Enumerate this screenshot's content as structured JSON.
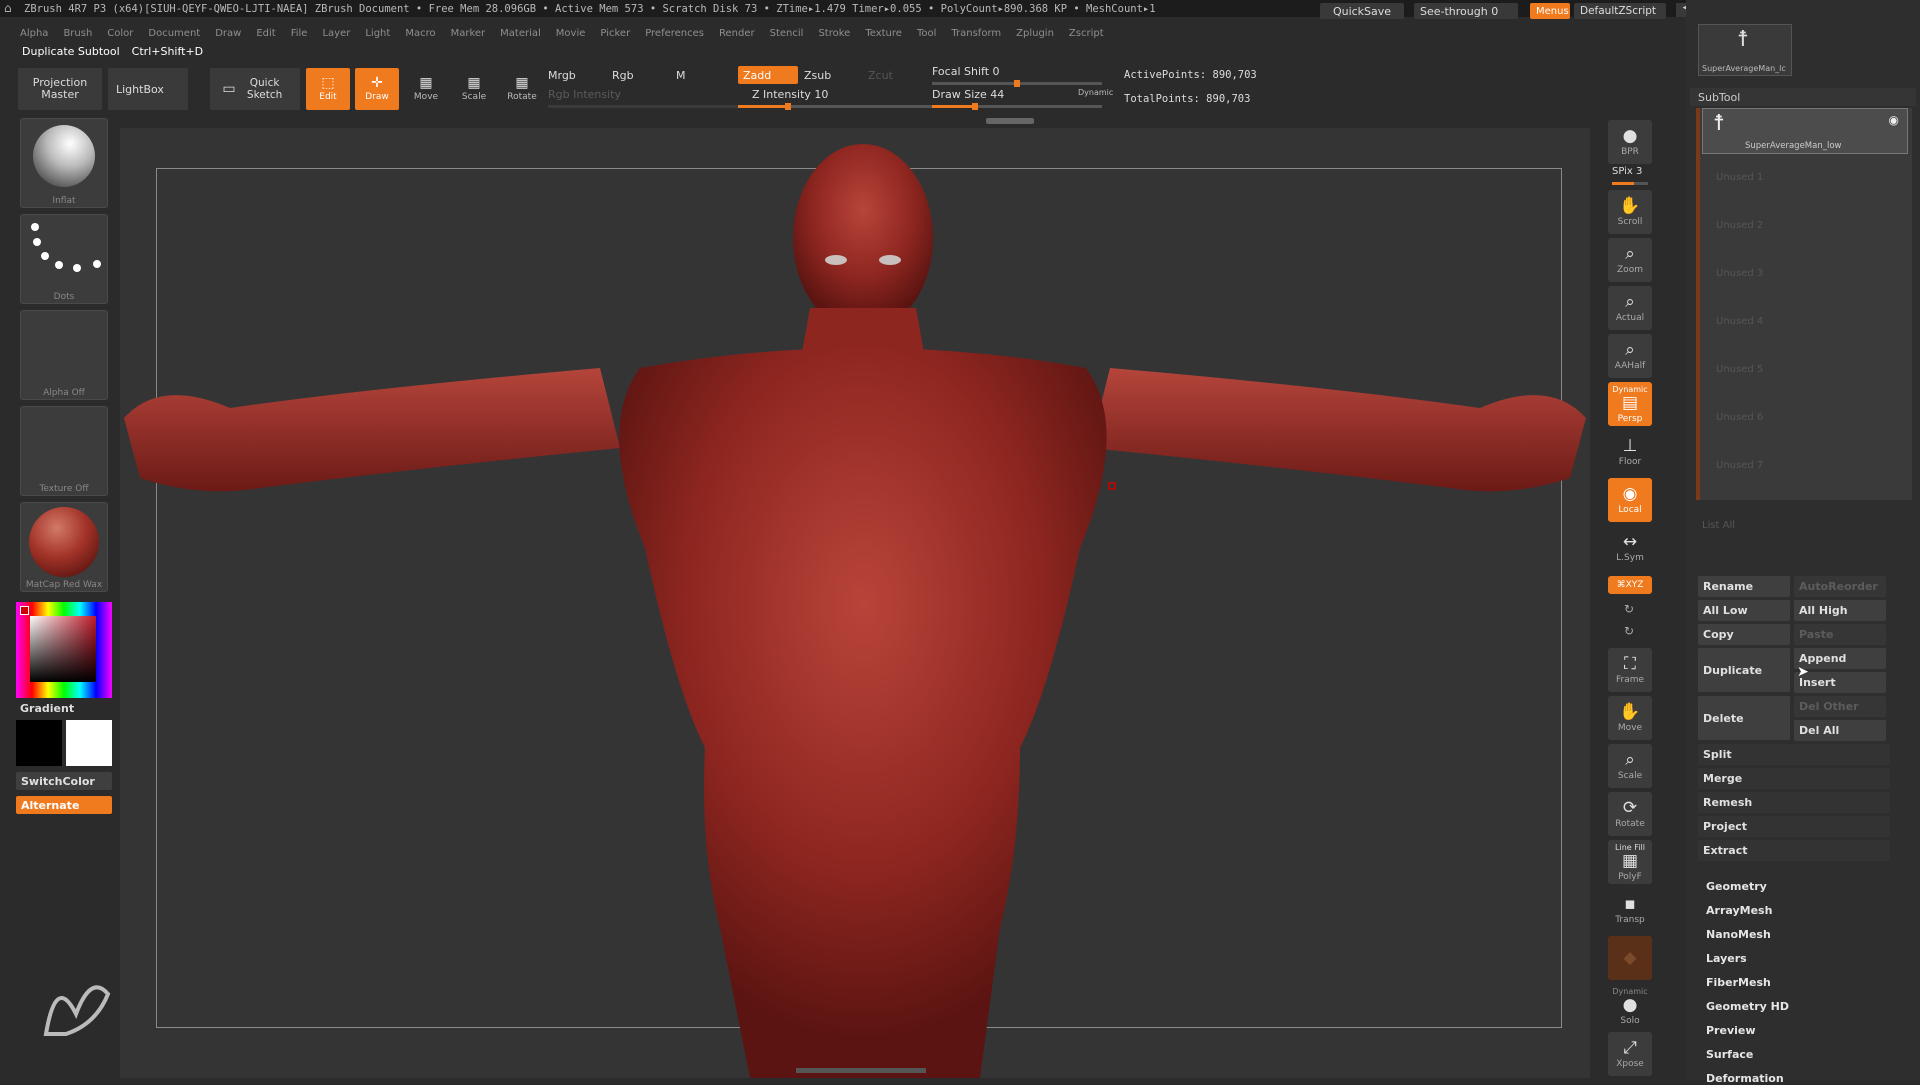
{
  "titlebar": {
    "text": "ZBrush 4R7 P3 (x64)[SIUH-QEYF-QWEO-LJTI-NAEA]   ZBrush Document    • Free Mem 28.096GB • Active Mem 573 • Scratch Disk 73 •  ZTime▸1.479 Timer▸0.055 • PolyCount▸890.368 KP  • MeshCount▸1",
    "quicksave": "QuickSave",
    "see_through": "See-through  0",
    "menus": "Menus",
    "default_zscript": "DefaultZScript"
  },
  "menubar": [
    "Alpha",
    "Brush",
    "Color",
    "Document",
    "Draw",
    "Edit",
    "File",
    "Layer",
    "Light",
    "Macro",
    "Marker",
    "Material",
    "Movie",
    "Picker",
    "Preferences",
    "Render",
    "Stencil",
    "Stroke",
    "Texture",
    "Tool",
    "Transform",
    "Zplugin",
    "Zscript"
  ],
  "cmdline": {
    "name": "Duplicate Subtool",
    "shortcut": "Ctrl+Shift+D"
  },
  "toolbar": {
    "projection_master": "Projection Master",
    "lightbox": "LightBox",
    "quick_sketch": "Quick Sketch",
    "edit": "Edit",
    "draw": "Draw",
    "move": "Move",
    "scale": "Scale",
    "rotate": "Rotate",
    "mrgb": "Mrgb",
    "rgb": "Rgb",
    "m": "M",
    "rgb_intensity": "Rgb Intensity",
    "zadd": "Zadd",
    "zsub": "Zsub",
    "zcut": "Zcut",
    "z_intensity": "Z Intensity 10",
    "z_intensity_value": 0.25,
    "focal_shift": "Focal Shift 0",
    "focal_shift_value": 0.5,
    "draw_size": "Draw Size 44",
    "draw_size_value": 0.25,
    "dynamic": "Dynamic",
    "active_points": "ActivePoints: 890,703",
    "total_points": "TotalPoints: 890,703"
  },
  "leftpanel": {
    "brush": "Inflat",
    "stroke": "Dots",
    "alpha": "Alpha Off",
    "texture": "Texture Off",
    "material": "MatCap Red Wax",
    "gradient": "Gradient",
    "switchcolor": "SwitchColor",
    "alternate": "Alternate"
  },
  "rightshelf": {
    "bpr": "BPR",
    "spix": "SPix 3",
    "scroll": "Scroll",
    "zoom": "Zoom",
    "actual": "Actual",
    "aahalf": "AAHalf",
    "dynamic": "Dynamic",
    "persp": "Persp",
    "floor": "Floor",
    "local": "Local",
    "lsym": "L.Sym",
    "xyz": "⌘XYZ",
    "frame": "Frame",
    "move": "Move",
    "scale": "Scale",
    "rotate": "Rotate",
    "line_fill": "Line Fill",
    "polyf": "PolyF",
    "transp": "Transp",
    "dynamic2": "Dynamic",
    "solo": "Solo",
    "xpose": "Xpose"
  },
  "rightpanel": {
    "top_tool": "SuperAverageMan_lc",
    "subtool_header": "SubTool",
    "active_subtool": "SuperAverageMan_low",
    "slots": [
      "Unused 1",
      "Unused 2",
      "Unused 3",
      "Unused 4",
      "Unused 5",
      "Unused 6",
      "Unused 7"
    ],
    "list_all": "List All",
    "rename": "Rename",
    "autoreorder": "AutoReorder",
    "all_low": "All Low",
    "all_high": "All High",
    "copy": "Copy",
    "paste": "Paste",
    "duplicate": "Duplicate",
    "append": "Append",
    "insert": "Insert",
    "delete": "Delete",
    "del_other": "Del Other",
    "del_all": "Del All",
    "split": "Split",
    "merge": "Merge",
    "remesh": "Remesh",
    "project": "Project",
    "extract": "Extract",
    "sections": [
      "Geometry",
      "ArrayMesh",
      "NanoMesh",
      "Layers",
      "FiberMesh",
      "Geometry HD",
      "Preview",
      "Surface",
      "Deformation"
    ]
  }
}
